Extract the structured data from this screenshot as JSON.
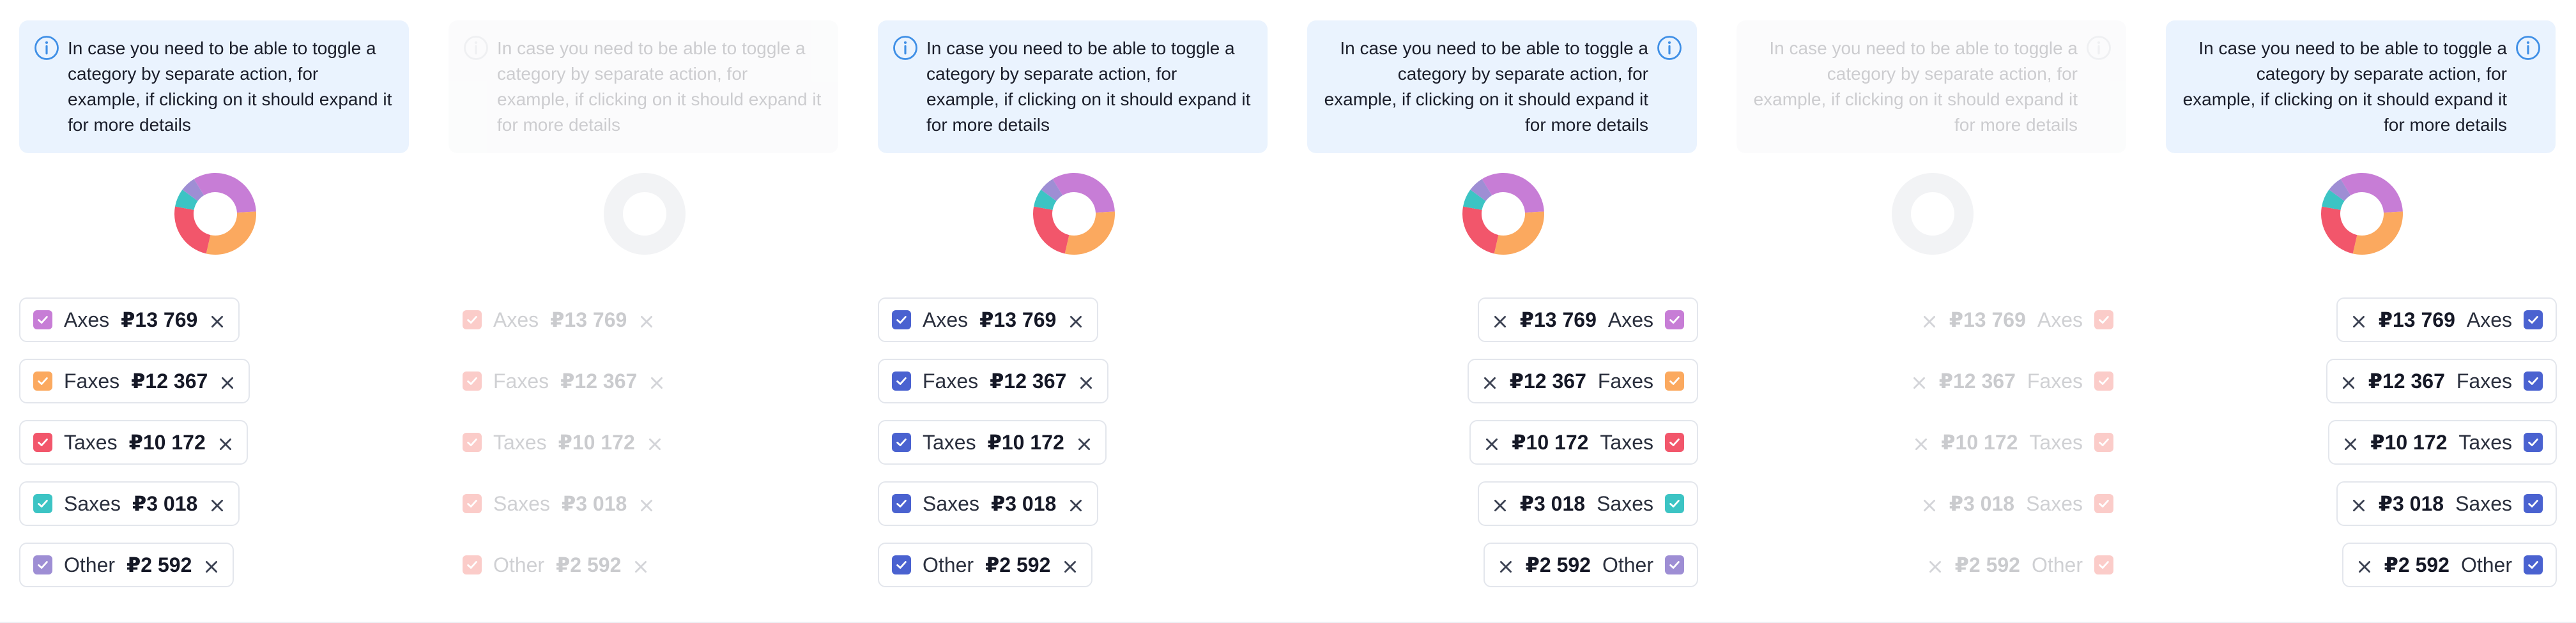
{
  "info_text": "In case you need to be able to toggle a category by separate action, for example, if clicking on it should expand it for more details",
  "categories": [
    {
      "label": "Axes",
      "amount": "₽13 769",
      "color": "#c77dd6"
    },
    {
      "label": "Faxes",
      "amount": "₽12 367",
      "color": "#fba95f"
    },
    {
      "label": "Taxes",
      "amount": "₽10 172",
      "color": "#f2566b"
    },
    {
      "label": "Saxes",
      "amount": "₽3 018",
      "color": "#3cc4c4"
    },
    {
      "label": "Other",
      "amount": "₽2 592",
      "color": "#9e8ed4"
    }
  ],
  "donut_values": [
    13769,
    12367,
    10172,
    3018,
    2592
  ],
  "panels": [
    {
      "direction": "ltr",
      "state": "default",
      "checkbox_style": "category-colors"
    },
    {
      "direction": "ltr",
      "state": "disabled",
      "checkbox_style": "red"
    },
    {
      "direction": "ltr",
      "state": "default",
      "checkbox_style": "blue"
    },
    {
      "direction": "rtl",
      "state": "default",
      "checkbox_style": "category-colors"
    },
    {
      "direction": "rtl",
      "state": "disabled",
      "checkbox_style": "red"
    },
    {
      "direction": "rtl",
      "state": "default",
      "checkbox_style": "blue"
    }
  ],
  "colors": {
    "info_bg": "#eaf3fe",
    "info_icon": "#3f8fe6",
    "blue_check": "#4a62d0",
    "red_check": "#ee1c0f",
    "chip_border": "#e3e6ec",
    "close_icon": "#3b4152"
  }
}
